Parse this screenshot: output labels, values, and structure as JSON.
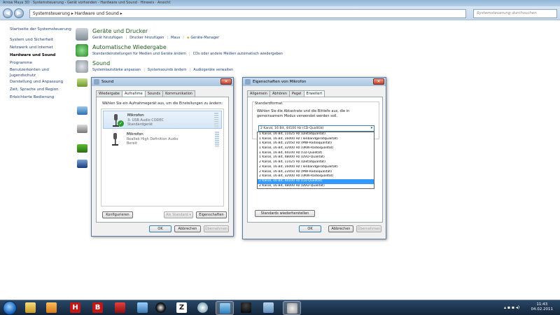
{
  "explorer": {
    "title": "Arrow Maya 3D · Systemsteuerung - Gerät vorhanden - Hardware und Sound · Hinweis · Ansicht",
    "breadcrumb": "Systemsteuerung  ▸  Hardware und Sound  ▸",
    "search_placeholder": "Systemsteuerung durchsuchen"
  },
  "sidebar": {
    "items": [
      {
        "label": "Startseite der Systemsteuerung"
      },
      {
        "label": "System und Sicherheit"
      },
      {
        "label": "Netzwerk und Internet"
      },
      {
        "label": "Hardware und Sound"
      },
      {
        "label": "Programme"
      },
      {
        "label": "Benutzerkonten und"
      },
      {
        "label": "Jugendschutz"
      },
      {
        "label": "Darstellung und Anpassung"
      },
      {
        "label": "Zeit, Sprache und Region"
      },
      {
        "label": "Erleichterte Bedienung"
      }
    ]
  },
  "categories": [
    {
      "title": "Geräte und Drucker",
      "links": [
        "Gerät hinzufügen",
        "Drucker hinzufügen",
        "Maus",
        "Geräte-Manager"
      ]
    },
    {
      "title": "Automatische Wiedergabe",
      "links": [
        "Standardeinstellungen für Medien und Geräte ändern",
        "CDs oder andere Medien automatisch wiedergeben"
      ]
    },
    {
      "title": "Sound",
      "links": [
        "Systemlautstärke anpassen",
        "Systemsounds ändern",
        "Audiogeräte verwalten"
      ]
    }
  ],
  "sound_dialog": {
    "title": "Sound",
    "tabs": [
      "Wiedergabe",
      "Aufnahme",
      "Sounds",
      "Kommunikation"
    ],
    "instruction": "Wählen Sie ein Aufnahmegerät aus, um die Einstellungen zu ändern:",
    "devices": [
      {
        "name": "Mikrofon",
        "line2": "3- USB Audio CODEC",
        "line3": "Standardgerät"
      },
      {
        "name": "Mikrofon",
        "line2": "Realtek High Definition Audio",
        "line3": "Bereit"
      }
    ],
    "configure_label": "Konfigurieren",
    "set_default_label": "Als Standard",
    "properties_label": "Eigenschaften",
    "ok_label": "OK",
    "cancel_label": "Abbrechen",
    "apply_label": "Übernehmen"
  },
  "props_dialog": {
    "title": "Eigenschaften von Mikrofon",
    "tabs": [
      "Allgemein",
      "Abhören",
      "Pegel",
      "Erweitert"
    ],
    "group_label": "Standardformat",
    "description": "Wählen Sie die Abtastrate und die Bittiefe aus, die in gemeinsamem Modus verwendet werden soll.",
    "selected_format": "2 Kanal, 16 Bit, 44100 Hz (CD-Qualität)",
    "options": [
      "1 Kanal, 16 Bit, 11025 Hz (Diktatqualität)",
      "1 Kanal, 16 Bit, 16000 Hz (Tonbandgerätqualität)",
      "1 Kanal, 16 Bit, 22050 Hz (MW-Radioqualität)",
      "1 Kanal, 16 Bit, 32000 Hz (UKW-Radioqualität)",
      "1 Kanal, 16 Bit, 44100 Hz (CD-Qualität)",
      "1 Kanal, 16 Bit, 48000 Hz (DVD-Qualität)",
      "2 Kanal, 16 Bit, 11025 Hz (Diktatqualität)",
      "2 Kanal, 16 Bit, 16000 Hz (Tonbandgerätqualität)",
      "2 Kanal, 16 Bit, 22050 Hz (MW-Radioqualität)",
      "2 Kanal, 16 Bit, 32000 Hz (UKW-Radioqualität)",
      "2 Kanal, 16 Bit, 44100 Hz (CD-Qualität)",
      "2 Kanal, 16 Bit, 48000 Hz (DVD-Qualität)"
    ],
    "restore_label": "Standards wiederherstellen",
    "ok_label": "OK",
    "cancel_label": "Abbrechen",
    "apply_label": "Übernehmen"
  },
  "taskbar": {
    "time": "11:43",
    "date": "04.02.2011",
    "icons": [
      "explorer-icon",
      "media-player-icon",
      "app-h-icon",
      "app-b-icon",
      "app-red-icon",
      "figure-icon",
      "circle-app-icon",
      "z-app-icon",
      "paint-icon",
      "control-panel-icon",
      "hat-icon",
      "network-icon",
      "sound-icon"
    ]
  },
  "colors": {
    "accent": "#3399ff",
    "category_title": "#1e5a1e",
    "link": "#1f3f78"
  }
}
